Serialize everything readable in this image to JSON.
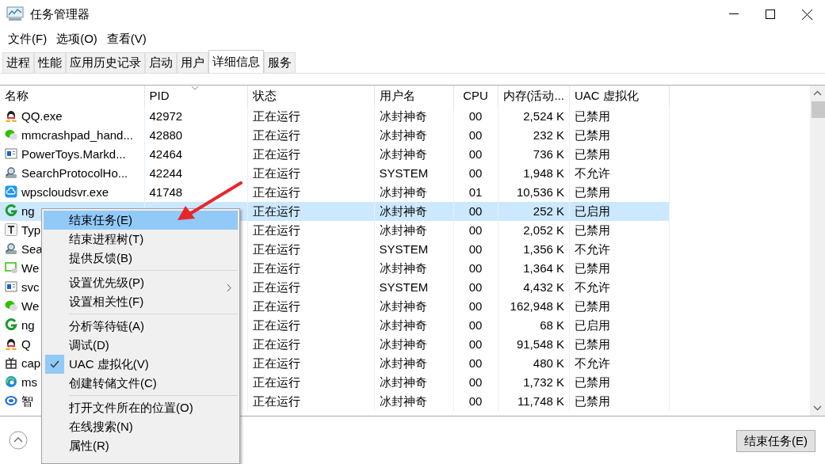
{
  "window": {
    "title": "任务管理器"
  },
  "menu_bar": [
    "文件(F)",
    "选项(O)",
    "查看(V)"
  ],
  "tabs": [
    {
      "label": "进程",
      "selected": false
    },
    {
      "label": "性能",
      "selected": false
    },
    {
      "label": "应用历史记录",
      "selected": false
    },
    {
      "label": "启动",
      "selected": false
    },
    {
      "label": "用户",
      "selected": false
    },
    {
      "label": "详细信息",
      "selected": true
    },
    {
      "label": "服务",
      "selected": false
    }
  ],
  "table": {
    "columns": [
      "名称",
      "PID",
      "状态",
      "用户名",
      "CPU",
      "内存(活动...",
      "UAC 虚拟化"
    ],
    "rows": [
      {
        "name": "QQ.exe",
        "pid": "42972",
        "status": "正在运行",
        "user": "冰封神奇",
        "cpu": "00",
        "memory": "2,524 K",
        "uac": "已禁用",
        "selected": false
      },
      {
        "name": "mmcrashpad_hand...",
        "pid": "42880",
        "status": "正在运行",
        "user": "冰封神奇",
        "cpu": "00",
        "memory": "232 K",
        "uac": "已禁用",
        "selected": false
      },
      {
        "name": "PowerToys.Markd...",
        "pid": "42464",
        "status": "正在运行",
        "user": "冰封神奇",
        "cpu": "00",
        "memory": "736 K",
        "uac": "已禁用",
        "selected": false
      },
      {
        "name": "SearchProtocolHo...",
        "pid": "42244",
        "status": "正在运行",
        "user": "SYSTEM",
        "cpu": "00",
        "memory": "1,948 K",
        "uac": "不允许",
        "selected": false
      },
      {
        "name": "wpscloudsvr.exe",
        "pid": "41748",
        "status": "正在运行",
        "user": "冰封神奇",
        "cpu": "01",
        "memory": "10,536 K",
        "uac": "已禁用",
        "selected": false
      },
      {
        "name": "ng",
        "status": "正在运行",
        "user": "冰封神奇",
        "cpu": "00",
        "memory": "252 K",
        "uac": "已启用",
        "selected": true
      },
      {
        "name": "Typ",
        "status": "正在运行",
        "user": "冰封神奇",
        "cpu": "00",
        "memory": "2,052 K",
        "uac": "已禁用",
        "selected": false
      },
      {
        "name": "Sea",
        "status": "正在运行",
        "user": "SYSTEM",
        "cpu": "00",
        "memory": "1,356 K",
        "uac": "不允许",
        "selected": false
      },
      {
        "name": "We",
        "status": "正在运行",
        "user": "冰封神奇",
        "cpu": "00",
        "memory": "1,364 K",
        "uac": "已禁用",
        "selected": false
      },
      {
        "name": "svc",
        "status": "正在运行",
        "user": "SYSTEM",
        "cpu": "00",
        "memory": "4,432 K",
        "uac": "不允许",
        "selected": false
      },
      {
        "name": "We",
        "status": "正在运行",
        "user": "冰封神奇",
        "cpu": "00",
        "memory": "162,948 K",
        "uac": "已禁用",
        "selected": false
      },
      {
        "name": "ng",
        "status": "正在运行",
        "user": "冰封神奇",
        "cpu": "00",
        "memory": "68 K",
        "uac": "已启用",
        "selected": false
      },
      {
        "name": "Q",
        "status": "正在运行",
        "user": "冰封神奇",
        "cpu": "00",
        "memory": "91,548 K",
        "uac": "已禁用",
        "selected": false
      },
      {
        "name": "cap",
        "status": "正在运行",
        "user": "冰封神奇",
        "cpu": "00",
        "memory": "480 K",
        "uac": "不允许",
        "selected": false
      },
      {
        "name": "ms",
        "status": "正在运行",
        "user": "冰封神奇",
        "cpu": "00",
        "memory": "1,732 K",
        "uac": "已禁用",
        "selected": false
      },
      {
        "name": "智",
        "status": "正在运行",
        "user": "冰封神奇",
        "cpu": "00",
        "memory": "11,748 K",
        "uac": "已禁用",
        "selected": false
      }
    ]
  },
  "context_menu": [
    {
      "kind": "item",
      "label": "结束任务(E)",
      "selected": true,
      "checked": false,
      "submenu": false
    },
    {
      "kind": "item",
      "label": "结束进程树(T)",
      "selected": false,
      "checked": false,
      "submenu": false
    },
    {
      "kind": "item",
      "label": "提供反馈(B)",
      "selected": false,
      "checked": false,
      "submenu": false
    },
    {
      "kind": "separator"
    },
    {
      "kind": "item",
      "label": "设置优先级(P)",
      "selected": false,
      "checked": false,
      "submenu": true
    },
    {
      "kind": "item",
      "label": "设置相关性(F)",
      "selected": false,
      "checked": false,
      "submenu": false
    },
    {
      "kind": "separator"
    },
    {
      "kind": "item",
      "label": "分析等待链(A)",
      "selected": false,
      "checked": false,
      "submenu": false
    },
    {
      "kind": "item",
      "label": "调试(D)",
      "selected": false,
      "checked": false,
      "submenu": false
    },
    {
      "kind": "item",
      "label": "UAC 虚拟化(V)",
      "selected": false,
      "checked": true,
      "submenu": false
    },
    {
      "kind": "item",
      "label": "创建转储文件(C)",
      "selected": false,
      "checked": false,
      "submenu": false
    },
    {
      "kind": "separator"
    },
    {
      "kind": "item",
      "label": "打开文件所在的位置(O)",
      "selected": false,
      "checked": false,
      "submenu": false
    },
    {
      "kind": "item",
      "label": "在线搜索(N)",
      "selected": false,
      "checked": false,
      "submenu": false
    },
    {
      "kind": "item",
      "label": "属性(R)",
      "selected": false,
      "checked": false,
      "submenu": false
    }
  ],
  "footer": {
    "end_task_button": "结束任务(E)"
  }
}
